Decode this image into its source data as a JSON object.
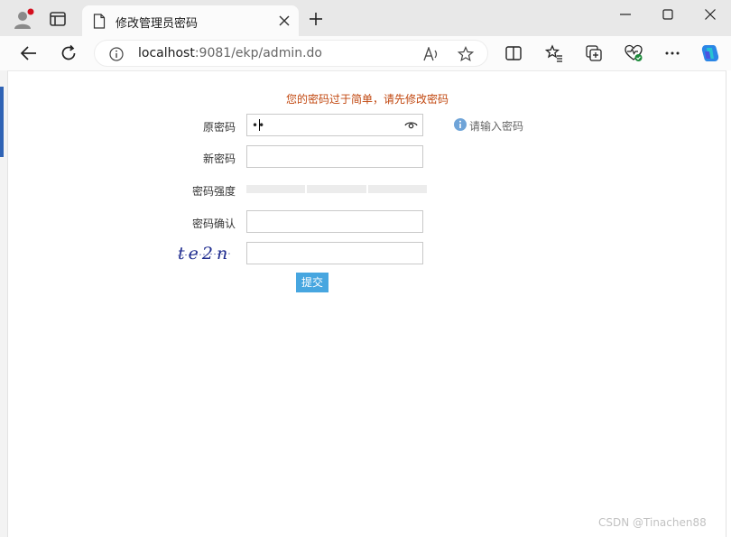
{
  "browser": {
    "tab": {
      "title": "修改管理员密码"
    },
    "address": {
      "host": "localhost",
      "rest": ":9081/ekp/admin.do"
    },
    "icons": [
      "profile-icon",
      "tab-actions-icon",
      "page-icon",
      "close-icon",
      "plus-icon",
      "minimize-icon",
      "maximize-icon",
      "close-window-icon",
      "back-icon",
      "refresh-icon",
      "info-icon",
      "read-aloud-icon",
      "favorite-star-icon",
      "split-screen-icon",
      "favorites-icon",
      "collections-icon",
      "health-icon",
      "more-icon",
      "copilot-icon"
    ]
  },
  "form": {
    "warning": "您的密码过于简单，请先修改密码",
    "old_password_label": "原密码",
    "old_password_value": "••",
    "old_password_hint": "请输入密码",
    "new_password_label": "新密码",
    "strength_label": "密码强度",
    "confirm_label": "密码确认",
    "captcha_text": "te2n",
    "submit_label": "提交"
  },
  "watermark": "CSDN @Tinachen88",
  "colors": {
    "warning": "#c1470f",
    "submit_bg": "#47a6e0",
    "hint_icon": "#6fa4d8",
    "captcha": "#1f2c8f"
  }
}
